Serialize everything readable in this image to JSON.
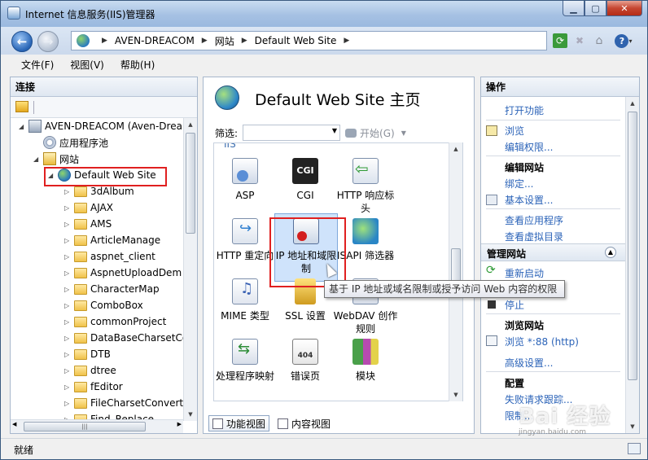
{
  "window": {
    "title": "Internet 信息服务(IIS)管理器"
  },
  "address": {
    "breadcrumbs": [
      "AVEN-DREACOM",
      "网站",
      "Default Web Site"
    ]
  },
  "menu": [
    "文件(F)",
    "视图(V)",
    "帮助(H)"
  ],
  "connections": {
    "header": "连接",
    "tree": [
      {
        "label": "AVEN-DREACOM (Aven-Drea",
        "icon": "server-icon"
      },
      {
        "label": "应用程序池",
        "icon": "app-pool-icon"
      },
      {
        "label": "网站",
        "icon": "sites-icon"
      },
      {
        "label": "Default Web Site",
        "icon": "globe-icon"
      },
      {
        "label": "3dAlbum"
      },
      {
        "label": "AJAX"
      },
      {
        "label": "AMS"
      },
      {
        "label": "ArticleManage"
      },
      {
        "label": "aspnet_client"
      },
      {
        "label": "AspnetUploadDem"
      },
      {
        "label": "CharacterMap"
      },
      {
        "label": "ComboBox"
      },
      {
        "label": "commonProject"
      },
      {
        "label": "DataBaseCharsetCo"
      },
      {
        "label": "DTB"
      },
      {
        "label": "dtree"
      },
      {
        "label": "fEditor"
      },
      {
        "label": "FileCharsetConvert"
      },
      {
        "label": "Find_Replace"
      }
    ]
  },
  "center": {
    "title": "Default Web Site 主页",
    "filter_label": "筛选:",
    "go_label": "开始(G)",
    "group_label": "IIS",
    "features": [
      {
        "label": "ASP",
        "icon": "asp-icon"
      },
      {
        "label": "CGI",
        "icon": "cgi-icon",
        "icon_text": "CGI"
      },
      {
        "label": "HTTP 响应标头",
        "icon": "http-response-headers-icon"
      },
      {
        "label": "HTTP 重定向",
        "icon": "http-redirect-icon"
      },
      {
        "label": "IP 地址和域限制",
        "icon": "ip-domain-restrictions-icon"
      },
      {
        "label": "ISAPI 筛选器",
        "icon": "isapi-filters-icon"
      },
      {
        "label": "MIME 类型",
        "icon": "mime-types-icon"
      },
      {
        "label": "SSL 设置",
        "icon": "ssl-lock-icon"
      },
      {
        "label": "WebDAV 创作规则",
        "icon": "webdav-icon",
        "icon_text": "DAV"
      },
      {
        "label": "处理程序映射",
        "icon": "handler-mappings-icon"
      },
      {
        "label": "错误页",
        "icon": "error-pages-icon",
        "icon_text": "404"
      },
      {
        "label": "模块",
        "icon": "modules-icon"
      }
    ],
    "tooltip": "基于 IP 地址或域名限制或授予访问 Web 内容的权限",
    "view_tabs": [
      "功能视图",
      "内容视图"
    ]
  },
  "actions": {
    "header": "操作",
    "open_feature": "打开功能",
    "browse": "浏览",
    "edit_perms": "编辑权限...",
    "edit_site_header": "编辑网站",
    "bindings": "绑定...",
    "basic_settings": "基本设置...",
    "view_apps": "查看应用程序",
    "view_vdirs": "查看虚拟目录",
    "manage_site_header": "管理网站",
    "restart": "重新启动",
    "stop": "停止",
    "browse_site_header": "浏览网站",
    "browse_port": "浏览 *:88 (http)",
    "advanced_settings": "高级设置...",
    "config_header": "配置",
    "failed_request": "失败请求跟踪...",
    "limits": "限制..."
  },
  "status": {
    "text": "就绪"
  },
  "watermark": {
    "text": "Bai 经验",
    "sub": "jingyan.baidu.com"
  },
  "colors": {
    "link": "#2b63b8",
    "highlight_border": "#e02020",
    "group_label": "#3e6fb0"
  }
}
